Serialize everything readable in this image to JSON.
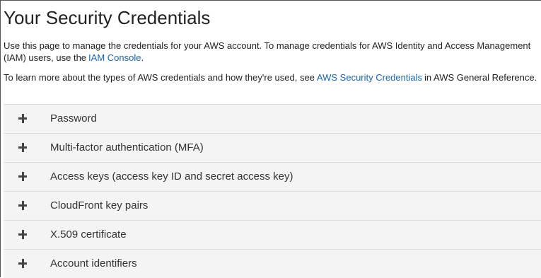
{
  "page": {
    "title": "Your Security Credentials",
    "intro_text": "Use this page to manage the credentials for your AWS account. To manage credentials for AWS Identity and Access Management (IAM) users, use the",
    "iam_console_link": "IAM Console",
    "intro_suffix": ".",
    "learn_text": "To learn more about the types of AWS credentials and how they're used, see",
    "security_credentials_link": "AWS Security Credentials",
    "learn_suffix": "in AWS General Reference."
  },
  "sections": [
    {
      "label": "Password",
      "icon": "plus-icon"
    },
    {
      "label": "Multi-factor authentication (MFA)",
      "icon": "plus-icon"
    },
    {
      "label": "Access keys (access key ID and secret access key)",
      "icon": "plus-icon"
    },
    {
      "label": "CloudFront key pairs",
      "icon": "plus-icon"
    },
    {
      "label": "X.509 certificate",
      "icon": "plus-icon"
    },
    {
      "label": "Account identifiers",
      "icon": "plus-icon"
    }
  ],
  "colors": {
    "link": "#1a66b3",
    "section_background": "#f4f4f4",
    "text": "#222222"
  }
}
